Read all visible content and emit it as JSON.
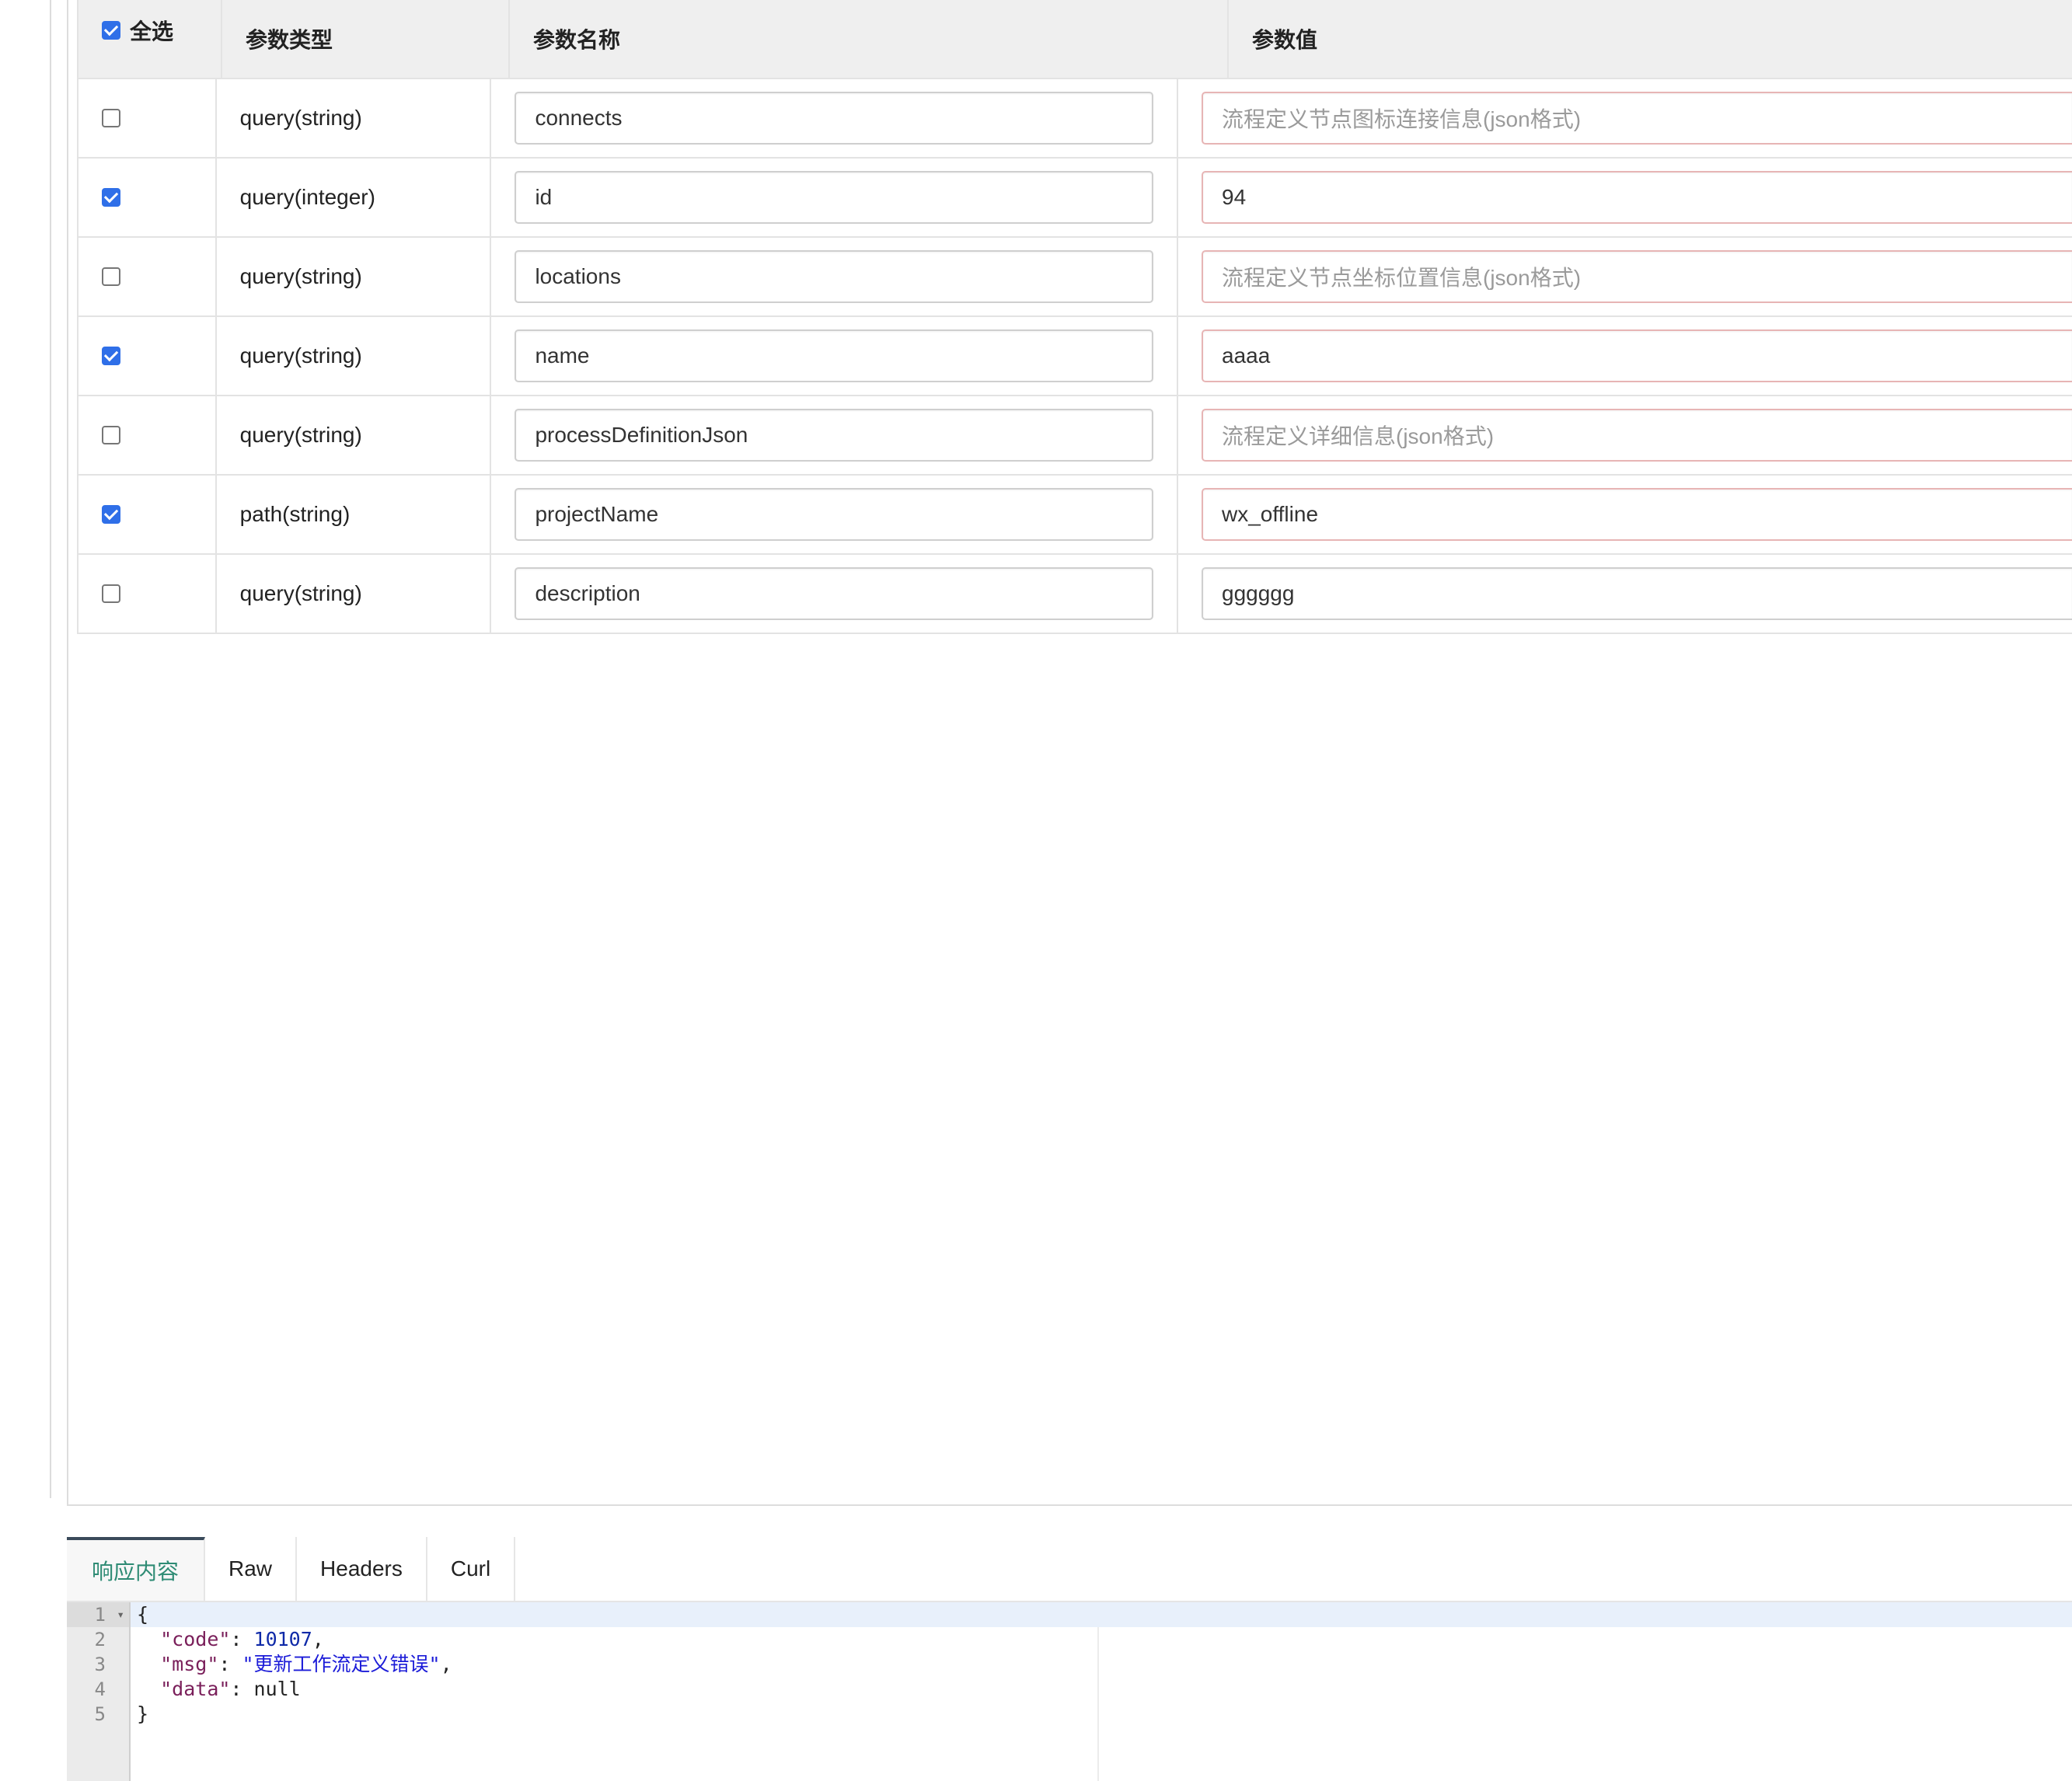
{
  "table": {
    "headers": {
      "select_all": "全选",
      "type": "参数类型",
      "name": "参数名称",
      "value": "参数值"
    },
    "select_all_checked": true,
    "rows": [
      {
        "checked": false,
        "type": "query(string)",
        "name": "connects",
        "value": "",
        "placeholder": "流程定义节点图标连接信息(json格式)",
        "required": true
      },
      {
        "checked": true,
        "type": "query(integer)",
        "name": "id",
        "value": "94",
        "placeholder": "",
        "required": true
      },
      {
        "checked": false,
        "type": "query(string)",
        "name": "locations",
        "value": "",
        "placeholder": "流程定义节点坐标位置信息(json格式)",
        "required": true
      },
      {
        "checked": true,
        "type": "query(string)",
        "name": "name",
        "value": "aaaa",
        "placeholder": "",
        "required": true
      },
      {
        "checked": false,
        "type": "query(string)",
        "name": "processDefinitionJson",
        "value": "",
        "placeholder": "流程定义详细信息(json格式)",
        "required": true
      },
      {
        "checked": true,
        "type": "path(string)",
        "name": "projectName",
        "value": "wx_offline",
        "placeholder": "",
        "required": true
      },
      {
        "checked": false,
        "type": "query(string)",
        "name": "description",
        "value": "gggggg",
        "placeholder": "",
        "required": false
      }
    ]
  },
  "response": {
    "tabs": [
      "响应内容",
      "Raw",
      "Headers",
      "Curl"
    ],
    "active_tab": 0,
    "line_numbers": [
      "1",
      "2",
      "3",
      "4",
      "5"
    ],
    "json": {
      "open": "{",
      "code_key": "\"code\"",
      "code_value": "10107",
      "msg_key": "\"msg\"",
      "msg_value": "\"更新工作流定义错误\"",
      "data_key": "\"data\"",
      "data_value": "null",
      "close": "}"
    }
  },
  "colors": {
    "checkbox_checked": "#2f6fe8",
    "required_border": "#e7b5b5",
    "active_tab_text": "#2e8b74",
    "json_key": "#7a1f5a",
    "json_number": "#0f2aa8",
    "json_string": "#1b1bd8"
  }
}
